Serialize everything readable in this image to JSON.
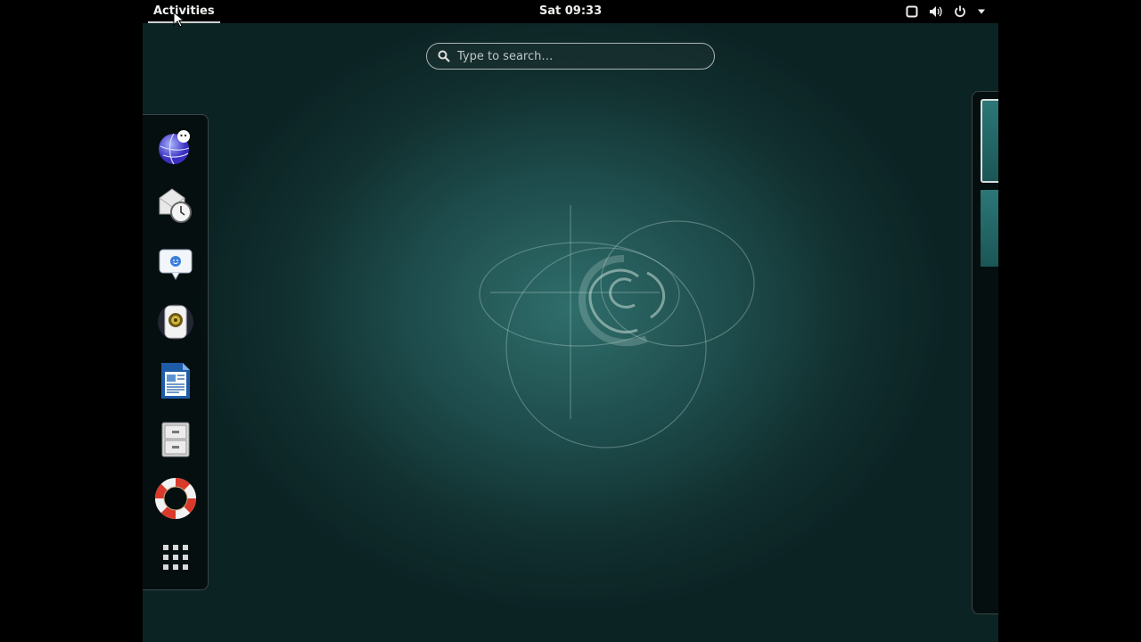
{
  "topbar": {
    "activities_label": "Activities",
    "clock": "Sat 09:33",
    "status_icons": [
      "window-icon",
      "volume-icon",
      "power-icon",
      "menu-arrow-icon"
    ]
  },
  "search": {
    "placeholder": "Type to search…"
  },
  "dash": {
    "items": [
      {
        "name": "web-browser",
        "icon": "globe-icon"
      },
      {
        "name": "mail-client",
        "icon": "mail-clock-icon"
      },
      {
        "name": "chat",
        "icon": "chat-bubble-icon"
      },
      {
        "name": "music-player",
        "icon": "speaker-icon"
      },
      {
        "name": "writer",
        "icon": "document-icon"
      },
      {
        "name": "file-manager",
        "icon": "filing-cabinet-icon"
      },
      {
        "name": "help",
        "icon": "lifebuoy-icon"
      },
      {
        "name": "show-applications",
        "icon": "app-grid-icon"
      }
    ]
  },
  "workspaces": {
    "count": 2,
    "active_index": 0
  },
  "colors": {
    "background": "#1d4a4a",
    "topbar": "#000000",
    "accent": "#cfcfcf"
  }
}
